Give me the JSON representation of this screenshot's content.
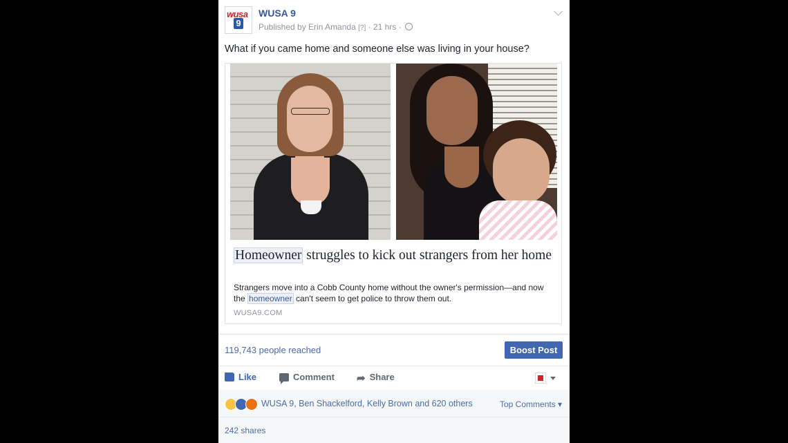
{
  "post": {
    "page_name": "WUSA 9",
    "published_by": "Published by Erin Amanda",
    "help_marker": "[?]",
    "separator": "·",
    "time_ago": "21 hrs",
    "message": "What if you came home and someone else was living in your house?",
    "avatar_text_top": "wusa",
    "avatar_text_bottom": "9"
  },
  "link_card": {
    "headline_highlight": "Homeowner",
    "headline_rest": " struggles to kick out strangers from her home",
    "description_before": "Strangers move into a Cobb County home without the owner's permission—and now the ",
    "description_highlight": "homeowner",
    "description_after": " can't seem to get police to throw them out.",
    "domain": "WUSA9.COM"
  },
  "insights": {
    "reach": "119,743 people reached",
    "boost_label": "Boost Post"
  },
  "actions": {
    "like": "Like",
    "comment": "Comment",
    "share": "Share"
  },
  "footer": {
    "reactors": "WUSA 9, Ben Shackelford, Kelly Brown and 620 others",
    "top_comments": "Top Comments",
    "top_comments_caret": "▾",
    "shares": "242 shares"
  },
  "reaction_icons": [
    "wow-icon",
    "like-icon",
    "angry-icon"
  ],
  "colors": {
    "link_blue": "#365899",
    "accent": "#4267b2",
    "background": "#000000"
  }
}
